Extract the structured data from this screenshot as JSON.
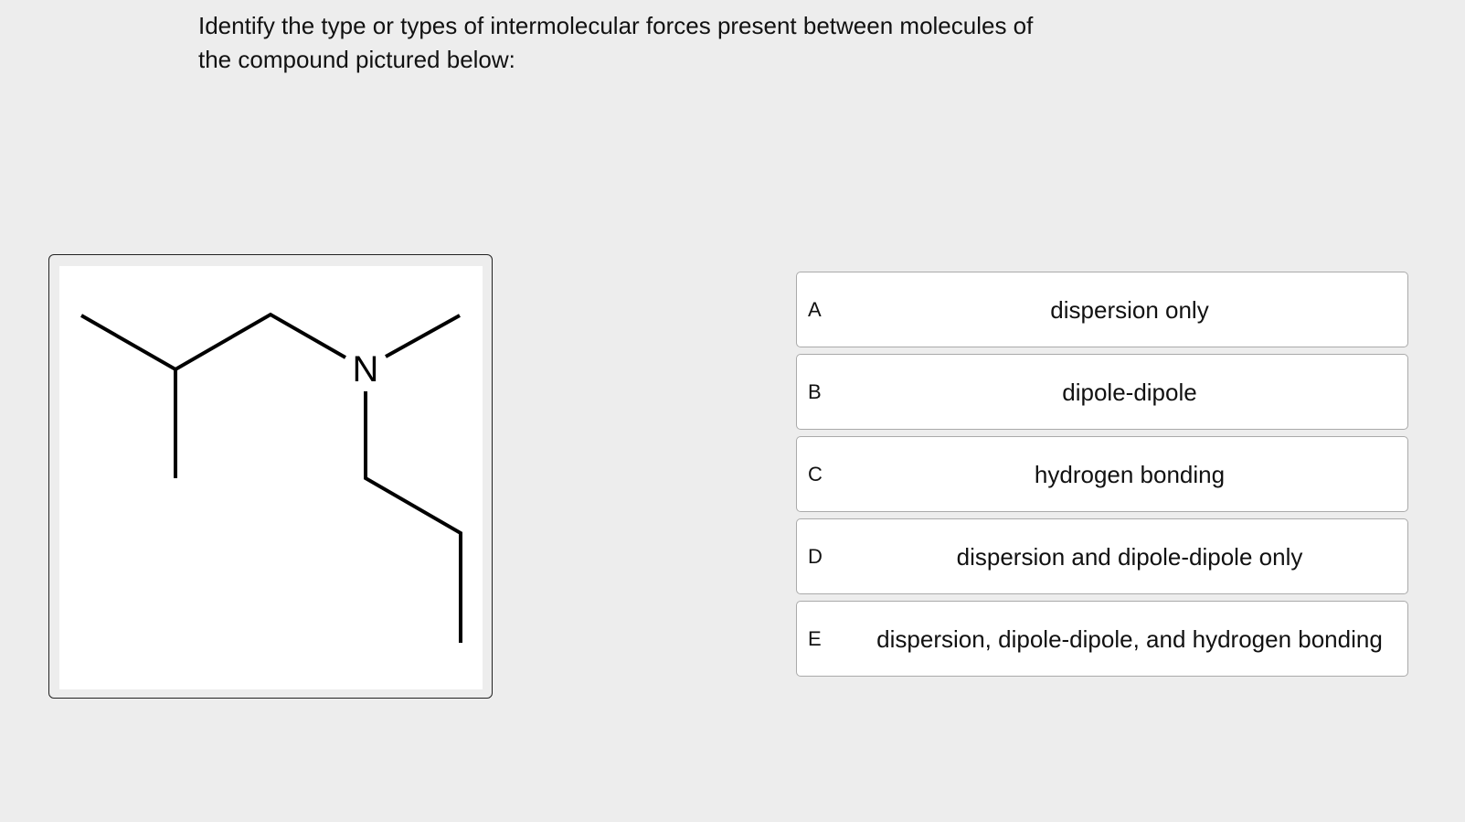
{
  "question": {
    "line1": "Identify the type or types of intermolecular forces present between molecules of",
    "line2": "the compound pictured below:"
  },
  "molecule": {
    "atom_label": "N"
  },
  "options": [
    {
      "letter": "A",
      "text": "dispersion only"
    },
    {
      "letter": "B",
      "text": "dipole-dipole"
    },
    {
      "letter": "C",
      "text": "hydrogen bonding"
    },
    {
      "letter": "D",
      "text": "dispersion and dipole-dipole only"
    },
    {
      "letter": "E",
      "text": "dispersion, dipole-dipole, and hydrogen bonding"
    }
  ]
}
